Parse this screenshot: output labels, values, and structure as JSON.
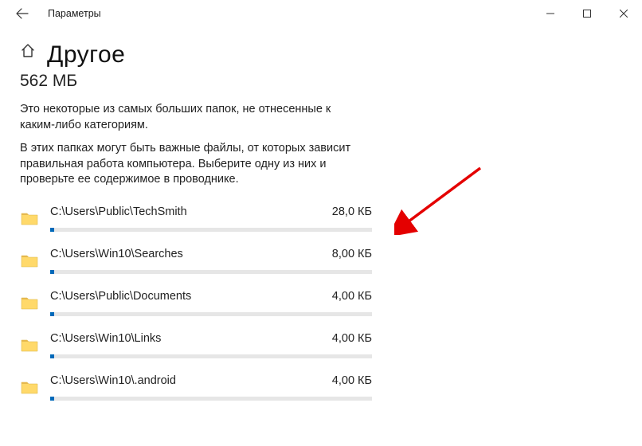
{
  "window": {
    "title": "Параметры"
  },
  "page": {
    "heading": "Другое",
    "total": "562 МБ",
    "desc1": "Это некоторые из самых больших папок, не отнесенные к каким-либо категориям.",
    "desc2": "В этих папках могут быть важные файлы, от которых зависит правильная работа компьютера. Выберите одну из них и проверьте ее содержимое в проводнике."
  },
  "folders": [
    {
      "path": "C:\\Users\\Public\\TechSmith",
      "size": "28,0 КБ",
      "fill_pct": 1.2
    },
    {
      "path": "C:\\Users\\Win10\\Searches",
      "size": "8,00 КБ",
      "fill_pct": 1.2
    },
    {
      "path": "C:\\Users\\Public\\Documents",
      "size": "4,00 КБ",
      "fill_pct": 1.2
    },
    {
      "path": "C:\\Users\\Win10\\Links",
      "size": "4,00 КБ",
      "fill_pct": 1.2
    },
    {
      "path": "C:\\Users\\Win10\\.android",
      "size": "4,00 КБ",
      "fill_pct": 1.2
    }
  ]
}
